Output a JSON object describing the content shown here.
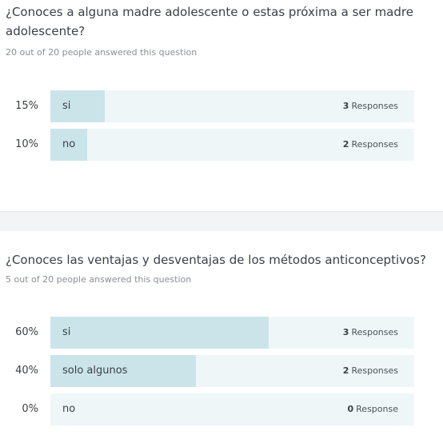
{
  "questions": [
    {
      "title": "¿Conoces a alguna madre adolescente o estas próxima a ser madre adolescente?",
      "meta": "20 out of 20 people answered this question",
      "answers": [
        {
          "percent_label": "15%",
          "percent": 15,
          "label": "si",
          "count": "3",
          "responses_label": "Responses"
        },
        {
          "percent_label": "10%",
          "percent": 10,
          "label": "no",
          "count": "2",
          "responses_label": "Responses"
        }
      ]
    },
    {
      "title": "¿Conoces las ventajas y desventajas de los métodos anticonceptivos?",
      "meta": "5 out of 20 people answered this question",
      "answers": [
        {
          "percent_label": "60%",
          "percent": 60,
          "label": "si",
          "count": "3",
          "responses_label": "Responses"
        },
        {
          "percent_label": "40%",
          "percent": 40,
          "label": "solo algunos",
          "count": "2",
          "responses_label": "Responses"
        },
        {
          "percent_label": "0%",
          "percent": 0,
          "label": "no",
          "count": "0",
          "responses_label": "Response"
        }
      ]
    }
  ],
  "colors": {
    "bar_track": "#eef6f8",
    "bar_fill": "#cbe4ea",
    "separator": "#f3f4f5"
  }
}
